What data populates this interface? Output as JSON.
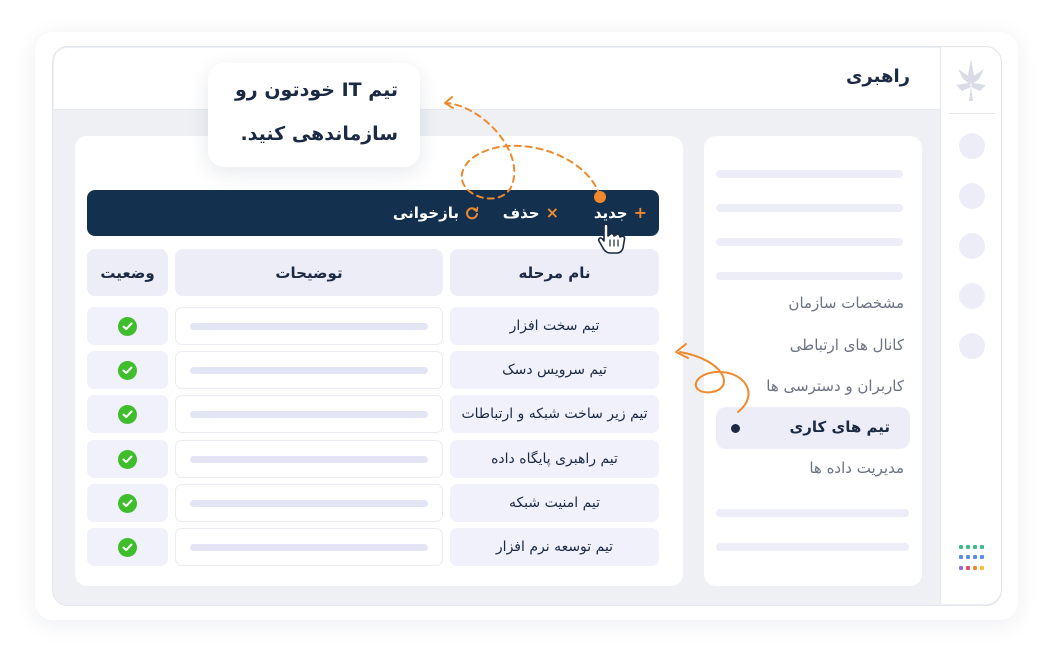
{
  "header": {
    "title": "راهبری"
  },
  "callout": {
    "line1": "تیم IT خودتون رو",
    "line2": "سازماندهی کنید."
  },
  "toolbar": {
    "new_label": "جدید",
    "new_icon": "plus-icon",
    "delete_label": "حذف",
    "delete_icon": "close-icon",
    "reload_label": "بازخوانی",
    "reload_icon": "refresh-icon"
  },
  "table": {
    "columns": [
      "نام مرحله",
      "توضیحات",
      "وضعیت"
    ],
    "rows": [
      {
        "name": "تیم سخت افزار",
        "status": "check-icon"
      },
      {
        "name": "تیم سرویس دسک",
        "status": "check-icon"
      },
      {
        "name": "تیم زیر ساخت شبکه و ارتباطات",
        "status": "check-icon"
      },
      {
        "name": "تیم راهبری پایگاه داده",
        "status": "check-icon"
      },
      {
        "name": "تیم امنیت شبکه",
        "status": "check-icon"
      },
      {
        "name": "تیم توسعه نرم افزار",
        "status": "check-icon"
      }
    ]
  },
  "sidebar": {
    "items": [
      {
        "label": "مشخصات سازمان"
      },
      {
        "label": "کانال های ارتباطی"
      },
      {
        "label": "کاربران و دسترسی ها"
      },
      {
        "label": "تیم های کاری",
        "active": true
      },
      {
        "label": "مدیریت داده ها"
      }
    ]
  },
  "colors": {
    "navy": "#13304f",
    "accent": "#f0892d",
    "success": "#3fbe2c",
    "muted": "#ededf8"
  }
}
